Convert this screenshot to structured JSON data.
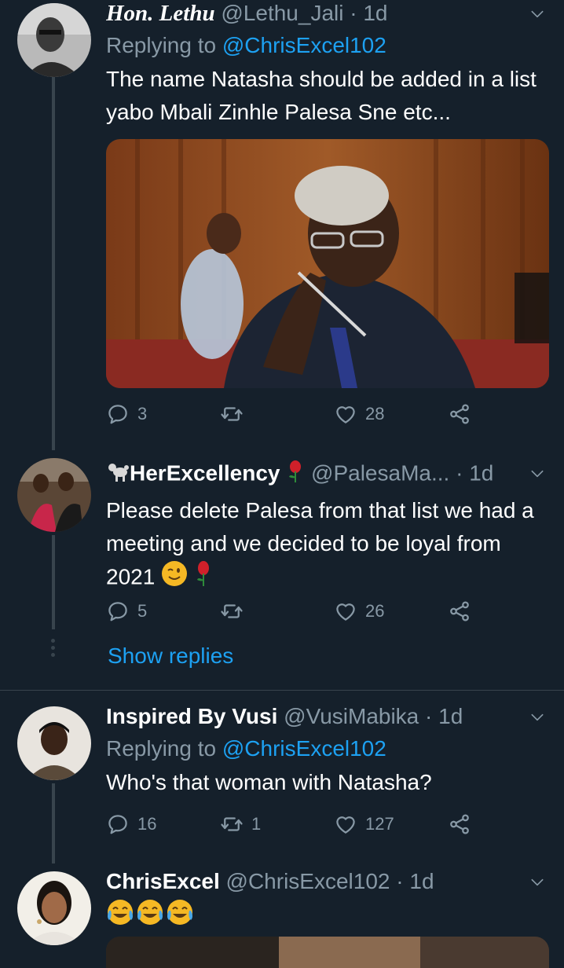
{
  "tweets": [
    {
      "name": "Hon. Lethu",
      "handle": "@Lethu_Jali",
      "dot": "·",
      "time": "1d",
      "replying_prefix": "Replying to",
      "replying_to": "@ChrisExcel102",
      "text": "The name Natasha should be added in a list yabo Mbali Zinhle Palesa Sne etc...",
      "replies": "3",
      "retweets": "",
      "likes": "28"
    },
    {
      "name": "HerExcellency",
      "handle": "@PalesaMa...",
      "dot": "·",
      "time": "1d",
      "text": "Please delete Palesa from that list we had a meeting and we decided to be loyal from 2021",
      "replies": "5",
      "retweets": "",
      "likes": "26",
      "show_replies": "Show replies"
    },
    {
      "name": "Inspired By Vusi",
      "handle": "@VusiMabika",
      "dot": "·",
      "time": "1d",
      "replying_prefix": "Replying to",
      "replying_to": "@ChrisExcel102",
      "text": "Who's that woman with Natasha?",
      "replies": "16",
      "retweets": "1",
      "likes": "127"
    },
    {
      "name": "ChrisExcel",
      "handle": "@ChrisExcel102",
      "dot": "·",
      "time": "1d"
    }
  ],
  "icons": {
    "reply": "reply-icon",
    "retweet": "retweet-icon",
    "like": "heart-icon",
    "share": "share-icon",
    "more": "chevron-down-icon"
  },
  "colors": {
    "background": "#15202b",
    "accent": "#1da1f2",
    "secondary_text": "#8899a6",
    "divider": "#38444d"
  }
}
